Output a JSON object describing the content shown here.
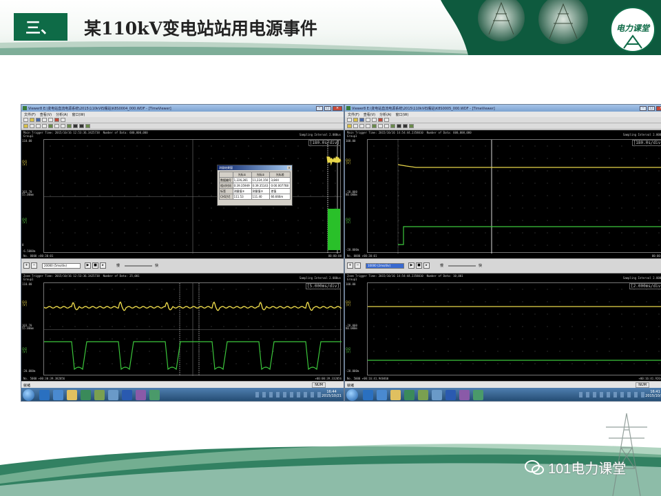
{
  "slide": {
    "section": "三、",
    "title": "某110kV变电站站用电源事件",
    "logo_text": "电力课堂",
    "watermark": "101电力课堂"
  },
  "colors": {
    "brand_green": "#0e6b47",
    "trace_yellow": "#e8d64a",
    "trace_green": "#3cc83c",
    "scope_bg": "#000000"
  },
  "shots": [
    {
      "window_title": "Viewer8 E:\\变电站直流电源系统\\2015\\110kV石嘴站\\K8S0004_000.WDF - [TimeViewer]",
      "menu": [
        "文件(F)",
        "查看(V)",
        "分析(A)",
        "窗口(W)"
      ],
      "main": {
        "header": "Main Trigger Time: 2015/10/16 12:53:36.3425738  Number of Data: 600,000,000\nGroup1",
        "sampling": "Sampling Interval  2.000us",
        "div": "[180.0s/div]",
        "y_labels": [
          {
            "text": "110.00",
            "cls": ""
          },
          {
            "text": "CH1\n[V]",
            "cls": "yellow"
          },
          {
            "text": "103.70\n55.00mm",
            "cls": ""
          },
          {
            "text": "CH2\n[V]",
            "cls": "green"
          },
          {
            "text": "0",
            "cls": ""
          },
          {
            "text": "-6.5000m",
            "cls": ""
          }
        ],
        "footer_left": "No. 0000  +00:30:01",
        "footer_right": "00:00:00"
      },
      "zoom_select": "20000 (5ms/div)",
      "speed_slow": "慢",
      "speed_fast": "快",
      "zoom": {
        "header": "Zoom Trigger Time: 2015/10/16 12:53:36.3425738  Number of Data: 25,001\nGroup1",
        "sampling": "Sampling Interval  2.000us",
        "div": "[5.000ms/div]",
        "y_labels": [
          {
            "text": "110.00",
            "cls": ""
          },
          {
            "text": "CH1\n[V]",
            "cls": "yellow"
          },
          {
            "text": "103.70\n55.00mm",
            "cls": ""
          },
          {
            "text": "CH2\n[V]",
            "cls": "green"
          },
          {
            "text": "-20.000m",
            "cls": ""
          }
        ],
        "footer_left": "No. 5000  +00:30:39.382056",
        "footer_right": "+00:00:39.332056"
      },
      "status_ready": "就绪",
      "status_num": "NUM",
      "clock_time": "16:44",
      "clock_date": "2015/10/21",
      "dialog": {
        "title": "测量结果窗",
        "headers": [
          "",
          "光标①",
          "光标②",
          "光标差"
        ],
        "rows": [
          [
            "数据编号",
            "1,226,281",
            "11,224,150",
            "3,844"
          ],
          [
            "相对时间",
            "0:39.35949",
            "0:39.35143",
            "0:00.007768"
          ],
          [
            "标签",
            "测量值①",
            "测量值②",
            "差值"
          ],
          [
            "CH1[V]",
            "111.53",
            "111.40",
            "66.666m"
          ]
        ]
      }
    },
    {
      "window_title": "Viewer8 E:\\变电站直流电源系统\\2015\\110kV石嘴站\\K8S0005_000.WDF - [TimeViewer]",
      "menu": [
        "文件(F)",
        "查看(V)",
        "分析(A)",
        "窗口(W)"
      ],
      "main": {
        "header": "Main Trigger Time: 2015/10/16 14:54:44.2358010  Number of Data: 600,000,000\nGroup1",
        "sampling": "Sampling Interval  2.000us",
        "div": "[180.0s/div]",
        "y_labels": [
          {
            "text": "100.00",
            "cls": ""
          },
          {
            "text": "CH1\n[V]",
            "cls": "yellow"
          },
          {
            "text": "-20.000\n80.000m",
            "cls": ""
          },
          {
            "text": "CH2\n[V]",
            "cls": "green"
          },
          {
            "text": "-20.000m",
            "cls": ""
          }
        ],
        "footer_left": "No. 0000  +00:30:01",
        "footer_right": "00:00:00"
      },
      "zoom_select": "10000 (2ms/div)",
      "speed_slow": "慢",
      "speed_fast": "快",
      "zoom": {
        "header": "Zoom Trigger Time: 2015/10/16 14:54:44.2358010  Number of Data: 10,001\nGroup1",
        "sampling": "Sampling Interval  2.000us",
        "div": "[2.000ms/div]",
        "y_labels": [
          {
            "text": "100.00",
            "cls": ""
          },
          {
            "text": "CH1\n[V]",
            "cls": "yellow"
          },
          {
            "text": "-20.000\n80.000m",
            "cls": ""
          },
          {
            "text": "CH2\n[V]",
            "cls": "green"
          },
          {
            "text": "-20.000m",
            "cls": ""
          }
        ],
        "footer_left": "No. 5000  +00:16:41.948460",
        "footer_right": "+00:16:41.926460"
      },
      "status_ready": "就绪",
      "status_num": "NUM",
      "clock_time": "16:41",
      "clock_date": "2015/10/21"
    }
  ]
}
